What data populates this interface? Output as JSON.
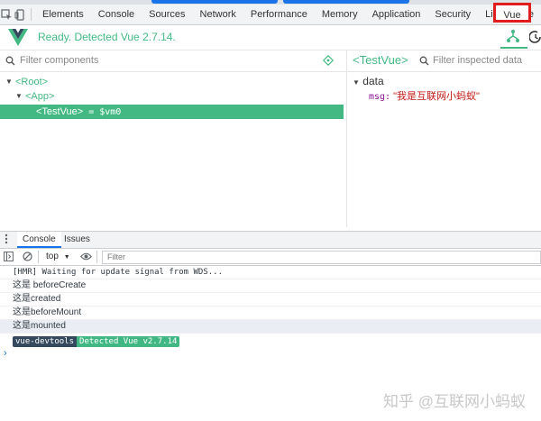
{
  "devtools": {
    "tabs": [
      "Elements",
      "Console",
      "Sources",
      "Network",
      "Performance",
      "Memory",
      "Application",
      "Security",
      "Lighthouse"
    ],
    "active_tab": "Vue"
  },
  "vue": {
    "status": "Ready. Detected Vue 2.7.14.",
    "filter_placeholder": "Filter components",
    "tree": {
      "root": "<Root>",
      "app": "<App>",
      "selected": "<TestVue>",
      "selected_ref": "= $vm0"
    },
    "inspector": {
      "component": "<TestVue>",
      "filter_placeholder": "Filter inspected data",
      "section": "data",
      "key": "msg:",
      "value": "\"我是互联网小蚂蚁\""
    },
    "accent_color": "#42b983"
  },
  "drawer": {
    "tabs": [
      "Console",
      "Issues"
    ],
    "context": "top",
    "filter_placeholder": "Filter"
  },
  "console": {
    "lines": [
      "[HMR] Waiting for update signal from WDS...",
      "这是 beforeCreate",
      "这是created",
      "这是beforeMount",
      "这是mounted"
    ],
    "badge_left": "vue-devtools",
    "badge_right": "Detected Vue v2.7.14",
    "prompt": "›"
  },
  "watermark": "知乎 @互联网小蚂蚁"
}
